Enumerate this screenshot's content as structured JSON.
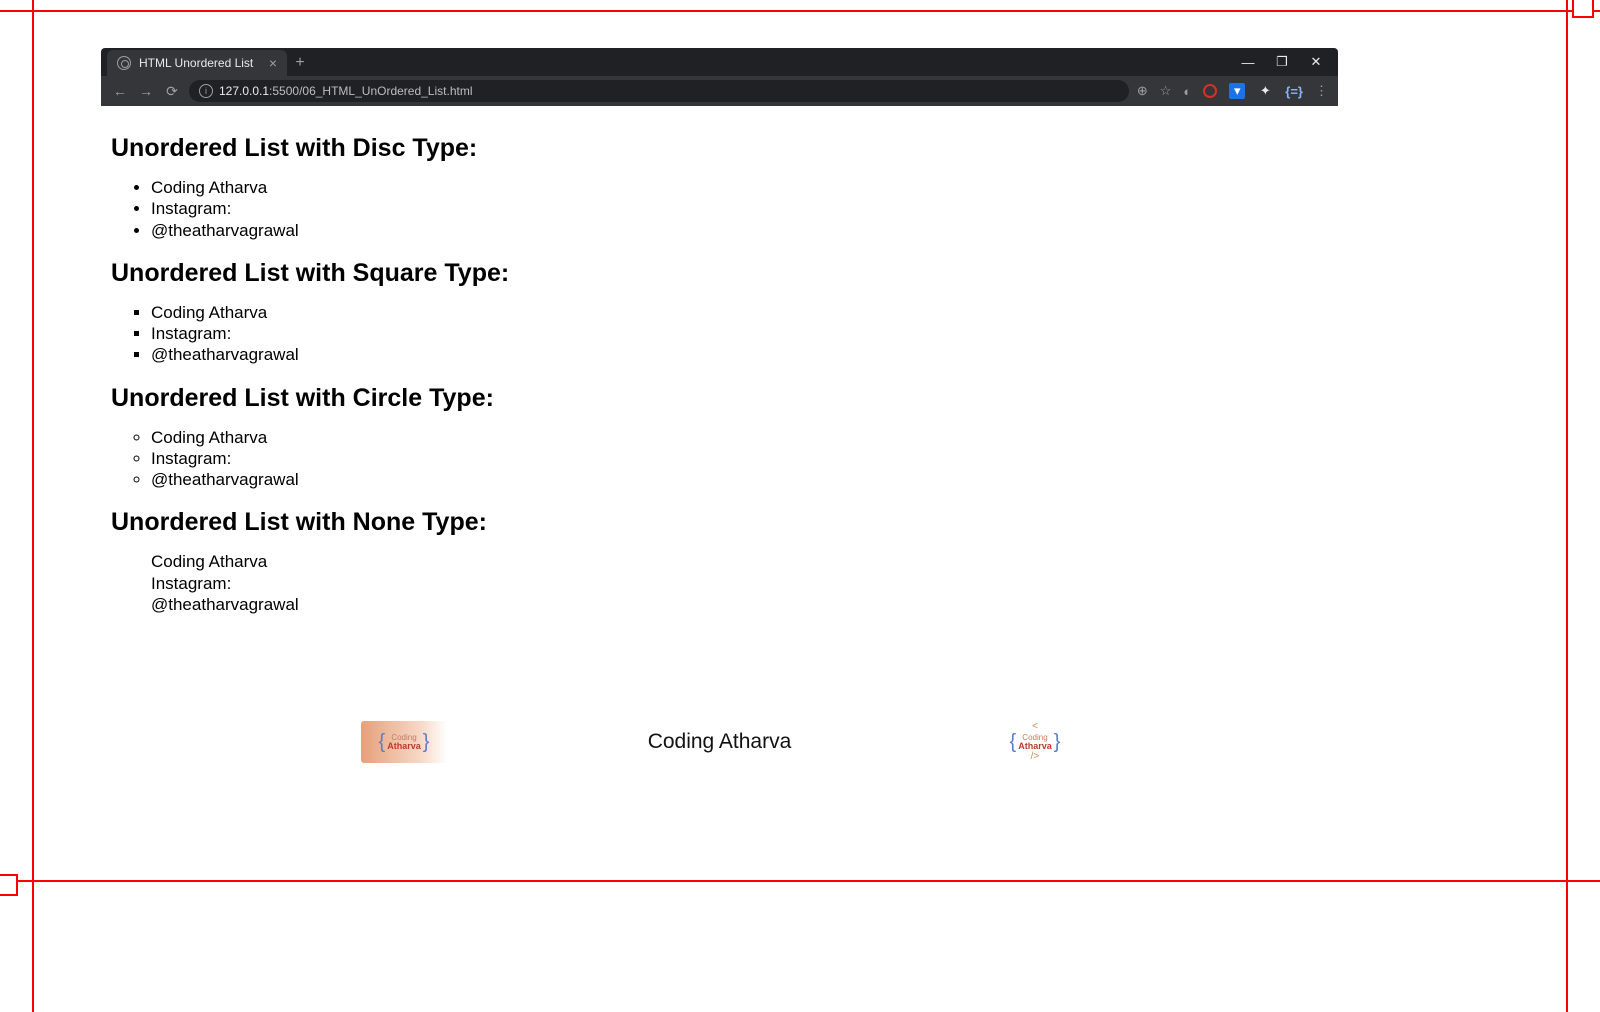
{
  "tab": {
    "title": "HTML Unordered List"
  },
  "address": {
    "host": "127.0.0.1",
    "path": ":5500/06_HTML_UnOrdered_List.html"
  },
  "page": {
    "sections": [
      {
        "heading": "Unordered List with Disc Type:",
        "items": [
          "Coding Atharva",
          "Instagram:",
          "@theatharvagrawal"
        ]
      },
      {
        "heading": "Unordered List with Square Type:",
        "items": [
          "Coding Atharva",
          "Instagram:",
          "@theatharvagrawal"
        ]
      },
      {
        "heading": "Unordered List with Circle Type:",
        "items": [
          "Coding Atharva",
          "Instagram:",
          "@theatharvagrawal"
        ]
      },
      {
        "heading": "Unordered List with None Type:",
        "items": [
          "Coding Atharva",
          "Instagram:",
          "@theatharvagrawal"
        ]
      }
    ]
  },
  "footer": {
    "brand_center": "Coding Atharva",
    "logo_line1": "Coding",
    "logo_line2": "Atharva"
  }
}
